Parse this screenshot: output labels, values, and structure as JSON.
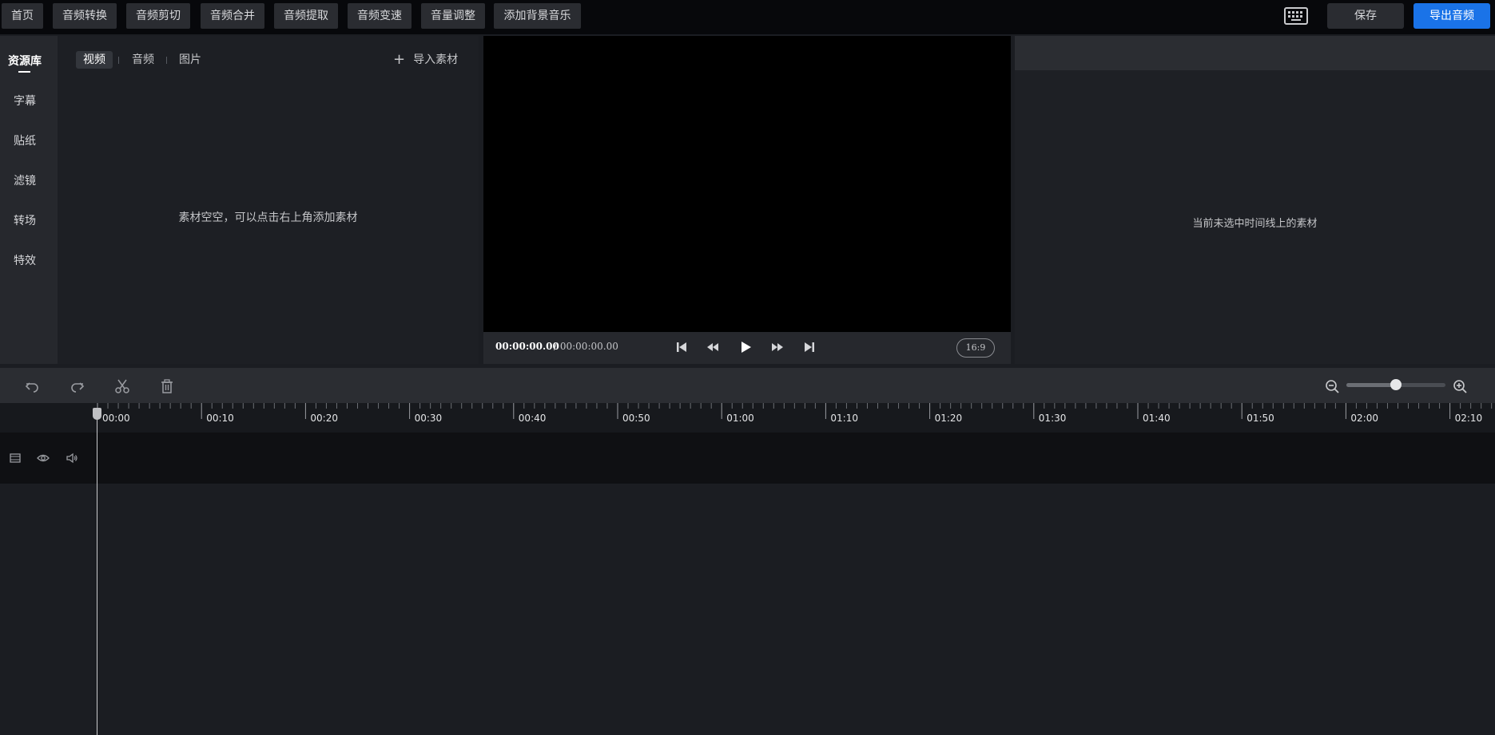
{
  "topbar": {
    "nav": [
      "首页",
      "音频转换",
      "音频剪切",
      "音频合并",
      "音频提取",
      "音频变速",
      "音量调整",
      "添加背景音乐"
    ],
    "keyboard_icon": "keyboard-icon",
    "save_label": "保存",
    "export_label": "导出音频",
    "export_color": "#1a73e8"
  },
  "sidebar": {
    "items": [
      "资源库",
      "字幕",
      "贴纸",
      "滤镜",
      "转场",
      "特效"
    ]
  },
  "assets": {
    "tabs": [
      "视频",
      "音频",
      "图片"
    ],
    "active_tab": "视频",
    "import_label": "导入素材",
    "empty_message": "素材空空，可以点击右上角添加素材"
  },
  "preview": {
    "current_time": "00:00:00.00",
    "total_time": "/ 00:00:00.00",
    "aspect_ratio": "16:9",
    "controls": [
      "skip-to-start-icon",
      "rewind-icon",
      "play-icon",
      "fast-forward-icon",
      "skip-to-end-icon"
    ]
  },
  "properties": {
    "empty_message": "当前未选中时间线上的素材"
  },
  "timeline": {
    "tools": [
      "undo-icon",
      "redo-icon",
      "cut-icon",
      "delete-icon"
    ],
    "zoom_level": 0.5,
    "ticks": [
      "00:00",
      "00:10",
      "00:20",
      "00:30",
      "00:40",
      "00:50",
      "01:00",
      "01:10",
      "01:20",
      "01:30",
      "01:40",
      "01:50",
      "02:00",
      "02:10"
    ],
    "track_controls": [
      "video-track-icon",
      "eye-icon",
      "volume-icon"
    ]
  }
}
